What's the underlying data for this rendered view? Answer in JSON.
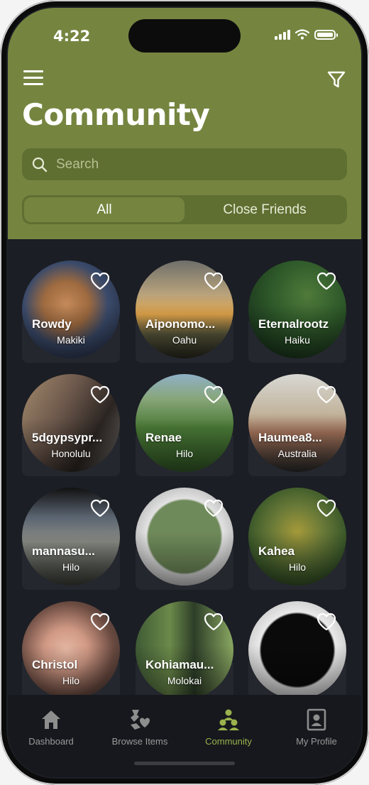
{
  "status": {
    "time": "4:22"
  },
  "header": {
    "title": "Community"
  },
  "search": {
    "placeholder": "Search"
  },
  "segments": {
    "all": "All",
    "close_friends": "Close Friends",
    "selected": "All"
  },
  "cards": [
    {
      "name": "Rowdy",
      "location": "Makiki",
      "bg": "radial-gradient(circle at 45% 45%, #c58a5a 0%, #9e6a3f 30%, #3a4a6a 55%, #1d2233 100%)"
    },
    {
      "name": "Aiponomo...",
      "location": "Oahu",
      "bg": "linear-gradient(to bottom, #6f6f6a 0%, #b9a37c 35%, #e0a44a 55%, #5b5a3e 75%, #2a2a20 100%)"
    },
    {
      "name": "Eternalrootz",
      "location": "Haiku",
      "bg": "radial-gradient(circle at 60% 35%, #4f7a3a 0%, #2f5a2a 40%, #1d3a1e 75%, #102014 100%)"
    },
    {
      "name": "5dgypsypr...",
      "location": "Honolulu",
      "bg": "linear-gradient(120deg, #a58b6d 0%, #6a564a 40%, #2b2522 70%, #6d6a66 100%)"
    },
    {
      "name": "Renae",
      "location": "Hilo",
      "bg": "linear-gradient(to bottom, #8fb0c7 0%, #88a67a 25%, #4a7a36 55%, #335a27 100%)"
    },
    {
      "name": "Haumea8...",
      "location": "Australia",
      "bg": "linear-gradient(to bottom, #d8d8d4 0%, #c2b49c 40%, #a07058 60%, #2a2a2a 100%)"
    },
    {
      "name": "mannasu...",
      "location": "Hilo",
      "bg": "linear-gradient(to bottom, #111 0%, #5a6470 30%, #8a8c86 55%, #3a3c36 100%)"
    },
    {
      "name": "",
      "location": "",
      "bg": "radial-gradient(circle, #6f8a5a 0%, #6f8a5a 52%, #e2e2e2 55%, #a7a7a7 90%, #e8e8e8 100%)"
    },
    {
      "name": "Kahea",
      "location": "Hilo",
      "bg": "radial-gradient(circle at 50% 45%, #a59a3a 0%, #6a7a38 35%, #3d5a2a 65%, #1e2e18 100%)"
    },
    {
      "name": "Christol",
      "location": "Hilo",
      "bg": "radial-gradient(circle at 45% 50%, #e6b8a4 0%, #cf9884 30%, #6a4a40 65%, #2a2a2a 100%)"
    },
    {
      "name": "Kohiamau...",
      "location": "Molokai",
      "bg": "linear-gradient(90deg, #3f5a35 0%, #6b8a4a 35%, #2d3e28 60%, #8aa862 100%)"
    },
    {
      "name": "",
      "location": "",
      "bg": "radial-gradient(circle, #0a0a0a 0%, #0a0a0a 52%, #e9e9e9 55%, #bdbdbd 88%, #f2f2f2 100%)"
    }
  ],
  "tabbar": {
    "items": [
      {
        "label": "Dashboard",
        "icon": "home-icon"
      },
      {
        "label": "Browse Items",
        "icon": "hands-heart-icon"
      },
      {
        "label": "Community",
        "icon": "community-icon"
      },
      {
        "label": "My Profile",
        "icon": "profile-icon"
      }
    ],
    "active": "Community"
  },
  "colors": {
    "header": "#758540",
    "accent": "#9bb24d",
    "background": "#1b1e24"
  }
}
